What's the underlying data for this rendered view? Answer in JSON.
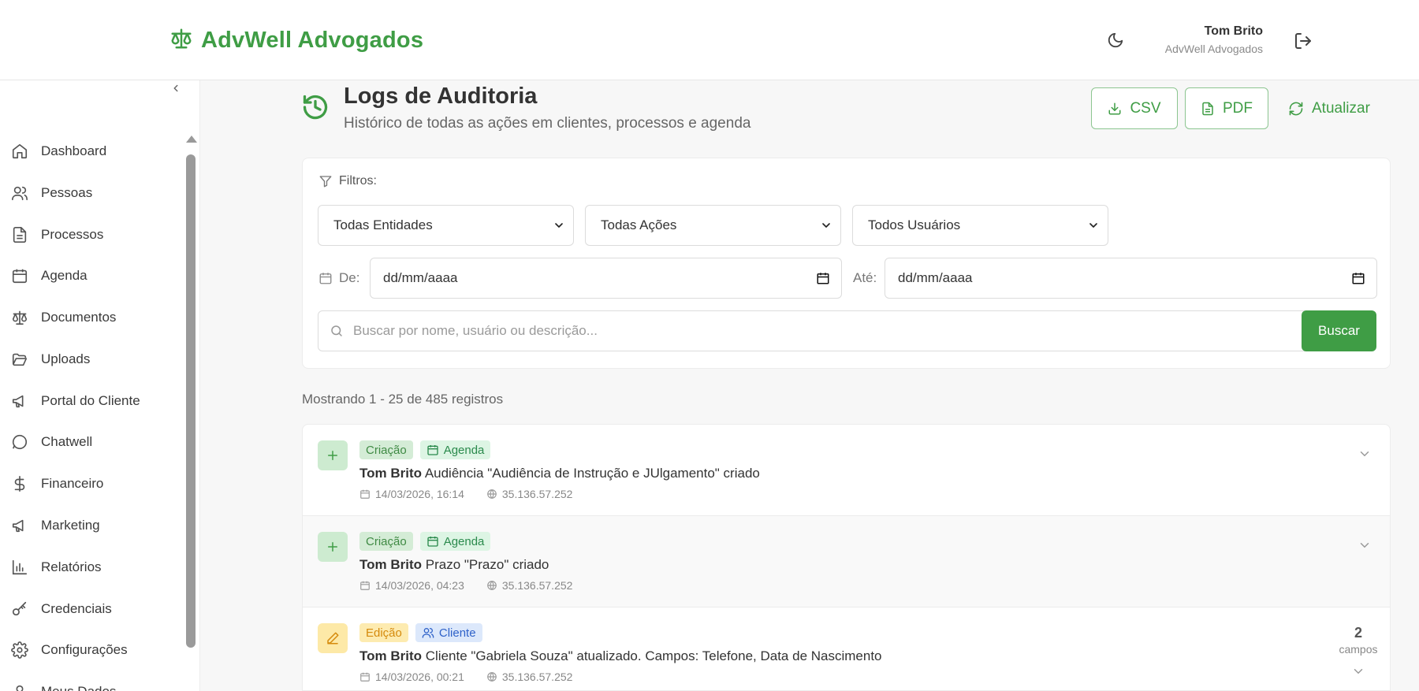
{
  "header": {
    "brand": "AdvWell Advogados",
    "user_name": "Tom Brito",
    "user_org": "AdvWell Advogados"
  },
  "sidebar": {
    "items": [
      {
        "label": "Dashboard",
        "icon": "home-icon"
      },
      {
        "label": "Pessoas",
        "icon": "users-icon"
      },
      {
        "label": "Processos",
        "icon": "file-text-icon"
      },
      {
        "label": "Agenda",
        "icon": "calendar-icon"
      },
      {
        "label": "Documentos",
        "icon": "scale-icon"
      },
      {
        "label": "Uploads",
        "icon": "folder-open-icon"
      },
      {
        "label": "Portal do Cliente",
        "icon": "megaphone-icon"
      },
      {
        "label": "Chatwell",
        "icon": "chat-bubble-icon"
      },
      {
        "label": "Financeiro",
        "icon": "dollar-icon"
      },
      {
        "label": "Marketing",
        "icon": "megaphone-icon"
      },
      {
        "label": "Relatórios",
        "icon": "bar-chart-icon"
      },
      {
        "label": "Credenciais",
        "icon": "key-icon"
      },
      {
        "label": "Configurações",
        "icon": "gear-icon"
      },
      {
        "label": "Meus Dados",
        "icon": "user-icon"
      }
    ]
  },
  "page": {
    "title": "Logs de Auditoria",
    "subtitle": "Histórico de todas as ações em clientes, processos e agenda",
    "csv_label": "CSV",
    "pdf_label": "PDF",
    "refresh_label": "Atualizar"
  },
  "filters": {
    "label": "Filtros:",
    "entity_selected": "Todas Entidades",
    "action_selected": "Todas Ações",
    "user_selected": "Todos Usuários",
    "from_label": "De:",
    "from_value": "dd/mm/aaaa",
    "to_label": "Até:",
    "to_value": "dd/mm/aaaa",
    "search_placeholder": "Buscar por nome, usuário ou descrição...",
    "search_button": "Buscar"
  },
  "count_text": "Mostrando 1 - 25 de 485 registros",
  "logs": [
    {
      "action": "Criação",
      "entity": "Agenda",
      "user": "Tom Brito",
      "description": "Audiência \"Audiência de Instrução e JUlgamento\" criado",
      "datetime": "14/03/2026, 16:14",
      "ip": "35.136.57.252"
    },
    {
      "action": "Criação",
      "entity": "Agenda",
      "user": "Tom Brito",
      "description": "Prazo \"Prazo\" criado",
      "datetime": "14/03/2026, 04:23",
      "ip": "35.136.57.252"
    },
    {
      "action": "Edição",
      "entity": "Cliente",
      "user": "Tom Brito",
      "description": "Cliente \"Gabriela Souza\" atualizado. Campos: Telefone, Data de Nascimento",
      "datetime": "14/03/2026, 00:21",
      "ip": "35.136.57.252",
      "fields_count": "2",
      "fields_label": "campos"
    }
  ],
  "colors": {
    "accent": "#3f9d45",
    "create_badge": "#d4ecd6",
    "edit_badge": "#fdebb0",
    "client_badge": "#dce8fb"
  }
}
